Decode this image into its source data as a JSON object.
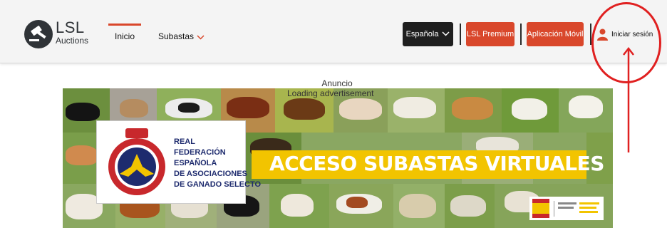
{
  "brand": {
    "name": "LSL",
    "subtitle": "Auctions"
  },
  "nav": {
    "inicio": "Inicio",
    "subastas": "Subastas"
  },
  "buttons": {
    "language": "Española",
    "premium": "LSL Premium",
    "app": "Aplicación Móvil"
  },
  "login": {
    "label": "Iniciar sesión",
    "icon": "user-icon"
  },
  "ad": {
    "label": "Anuncio",
    "loading": "Loading advertisement"
  },
  "banner": {
    "org_lines": [
      "REAL",
      "FEDERACIÓN",
      "ESPAÑOLA",
      "DE ASOCIACIONES",
      "DE GANADO SELECTO"
    ],
    "seal_text": "REAL FEDERACIÓN ESPAÑOLA DE ASOCIACIONES DE GANADO SELECTO",
    "headline": "ACCESO SUBASTAS VIRTUALES"
  },
  "colors": {
    "accent": "#d9472b",
    "dark": "#1f1f1f",
    "annotation": "#e02020",
    "banner_yellow": "#f2c400",
    "seal_blue": "#1e2b6e"
  }
}
